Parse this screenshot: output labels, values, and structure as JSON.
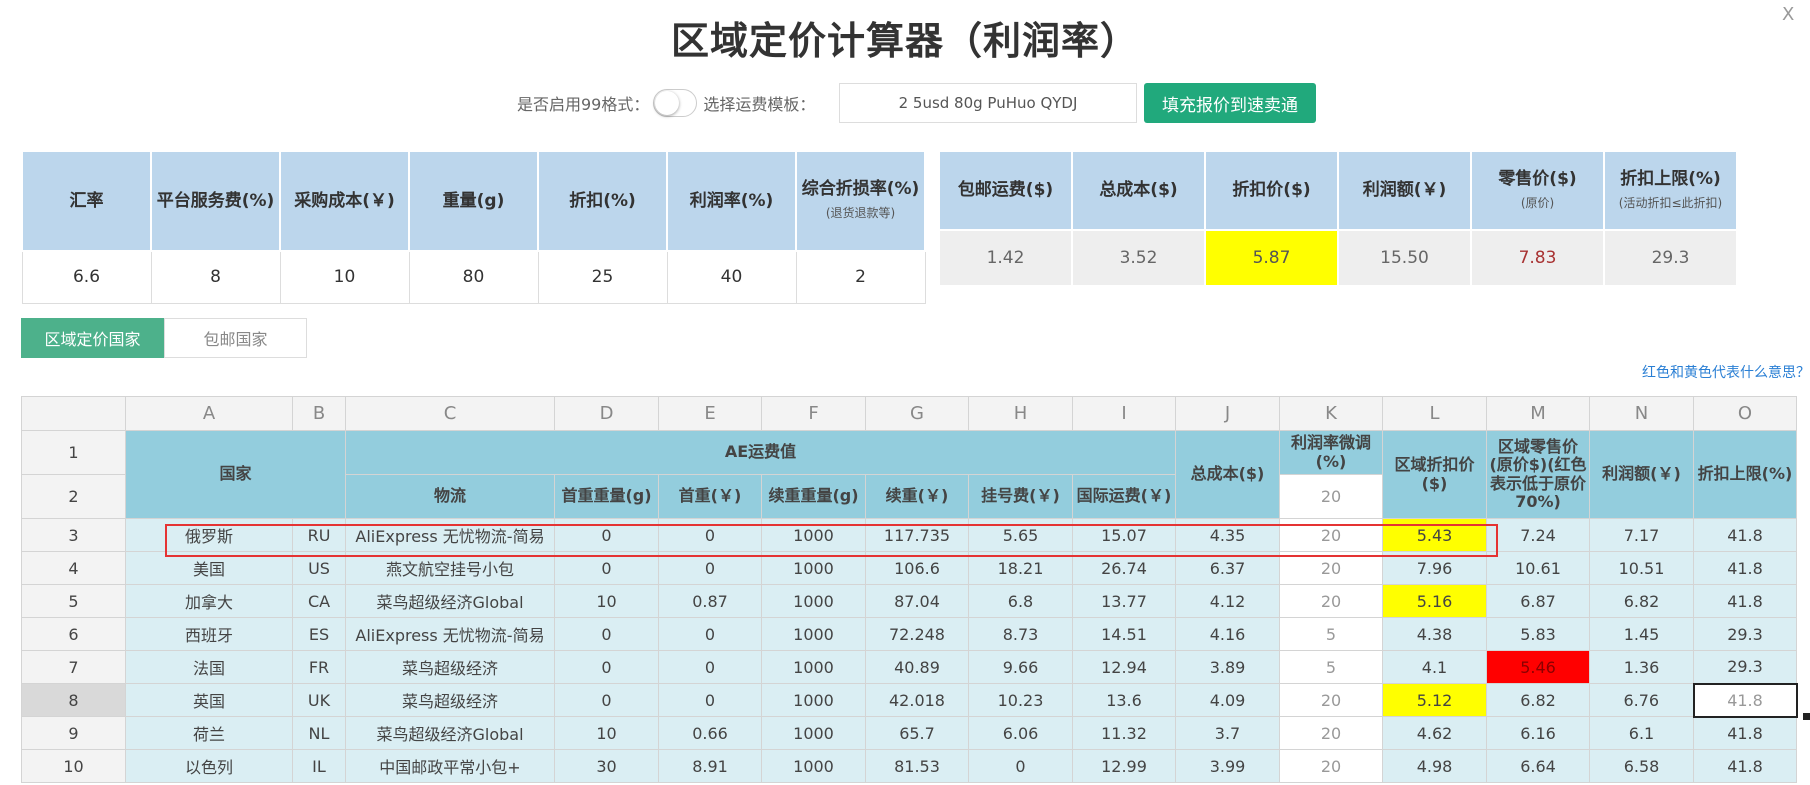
{
  "close_label": "X",
  "title": "区域定价计算器（利润率）",
  "options": {
    "format99_label": "是否启用99格式：",
    "template_label": "选择运费模板：",
    "template_value": "2 5usd 80g PuHuo QYDJ",
    "fill_button": "填充报价到速卖通"
  },
  "params": {
    "headers": [
      {
        "main": "汇率",
        "sub": ""
      },
      {
        "main": "平台服务费(%)",
        "sub": ""
      },
      {
        "main": "采购成本(￥)",
        "sub": ""
      },
      {
        "main": "重量(g)",
        "sub": ""
      },
      {
        "main": "折扣(%)",
        "sub": ""
      },
      {
        "main": "利润率(%)",
        "sub": ""
      },
      {
        "main": "综合折损率(%)",
        "sub": "(退货退款等)"
      }
    ],
    "values": [
      "6.6",
      "8",
      "10",
      "80",
      "25",
      "40",
      "2"
    ]
  },
  "results": {
    "headers": [
      {
        "main": "包邮运费($)",
        "sub": ""
      },
      {
        "main": "总成本($)",
        "sub": ""
      },
      {
        "main": "折扣价($)",
        "sub": ""
      },
      {
        "main": "利润额(￥)",
        "sub": ""
      },
      {
        "main": "零售价($)",
        "sub": "(原价)"
      },
      {
        "main": "折扣上限(%)",
        "sub": "(活动折扣≤此折扣)"
      }
    ],
    "values": [
      "1.42",
      "3.52",
      "5.87",
      "15.50",
      "7.83",
      "29.3"
    ]
  },
  "tabs": [
    "区域定价国家",
    "包邮国家"
  ],
  "help_link": "红色和黄色代表什么意思？",
  "sheet": {
    "columns": [
      "A",
      "B",
      "C",
      "D",
      "E",
      "F",
      "G",
      "H",
      "I",
      "J",
      "K",
      "L",
      "M",
      "N",
      "O"
    ],
    "header": {
      "country": "国家",
      "ae_fee": "AE运费值",
      "logistics": "物流",
      "first_weight": "首重重量(g)",
      "first_fee": "首重(￥)",
      "cont_weight": "续重重量(g)",
      "cont_fee": "续重(￥)",
      "reg_fee": "挂号费(￥)",
      "intl_fee": "国际运费(￥)",
      "total_cost": "总成本($)",
      "profit_adj": "利润率微调(%)",
      "profit_adj_value": "20",
      "region_discount": "区域折扣价($)",
      "region_retail": "区域零售价(原价$)(红色表示低于原价70%)",
      "profit_amount": "利润额(￥)",
      "discount_cap": "折扣上限(%)"
    },
    "rows": [
      {
        "n": "3",
        "cells": [
          "俄罗斯",
          "RU",
          "AliExpress 无忧物流-简易",
          "0",
          "0",
          "1000",
          "117.735",
          "5.65",
          "15.07",
          "4.35",
          "20",
          "5.43",
          "7.24",
          "7.17",
          "41.8"
        ]
      },
      {
        "n": "4",
        "cells": [
          "美国",
          "US",
          "燕文航空挂号小包",
          "0",
          "0",
          "1000",
          "106.6",
          "18.21",
          "26.74",
          "6.37",
          "20",
          "7.96",
          "10.61",
          "10.51",
          "41.8"
        ]
      },
      {
        "n": "5",
        "cells": [
          "加拿大",
          "CA",
          "菜鸟超级经济Global",
          "10",
          "0.87",
          "1000",
          "87.04",
          "6.8",
          "13.77",
          "4.12",
          "20",
          "5.16",
          "6.87",
          "6.82",
          "41.8"
        ]
      },
      {
        "n": "6",
        "cells": [
          "西班牙",
          "ES",
          "AliExpress 无忧物流-简易",
          "0",
          "0",
          "1000",
          "72.248",
          "8.73",
          "14.51",
          "4.16",
          "5",
          "4.38",
          "5.83",
          "1.45",
          "29.3"
        ]
      },
      {
        "n": "7",
        "cells": [
          "法国",
          "FR",
          "菜鸟超级经济",
          "0",
          "0",
          "1000",
          "40.89",
          "9.66",
          "12.94",
          "3.89",
          "5",
          "4.1",
          "5.46",
          "1.36",
          "29.3"
        ]
      },
      {
        "n": "8",
        "cells": [
          "英国",
          "UK",
          "菜鸟超级经济",
          "0",
          "0",
          "1000",
          "42.018",
          "10.23",
          "13.6",
          "4.09",
          "20",
          "5.12",
          "6.82",
          "6.76",
          "41.8"
        ]
      },
      {
        "n": "9",
        "cells": [
          "荷兰",
          "NL",
          "菜鸟超级经济Global",
          "10",
          "0.66",
          "1000",
          "65.7",
          "6.06",
          "11.32",
          "3.7",
          "20",
          "4.62",
          "6.16",
          "6.1",
          "41.8"
        ]
      },
      {
        "n": "10",
        "cells": [
          "以色列",
          "IL",
          "中国邮政平常小包+",
          "30",
          "8.91",
          "1000",
          "81.53",
          "0",
          "12.99",
          "3.99",
          "20",
          "4.98",
          "6.64",
          "6.58",
          "41.8"
        ]
      }
    ]
  },
  "colors": {
    "accent": "#21a97c",
    "tab_active": "#4db18b",
    "header_bg": "#bcd6ec",
    "sheet_header": "#93cddd",
    "sheet_body": "#daeef3",
    "highlight_yellow": "#ffff00",
    "highlight_red": "#ff0000"
  }
}
